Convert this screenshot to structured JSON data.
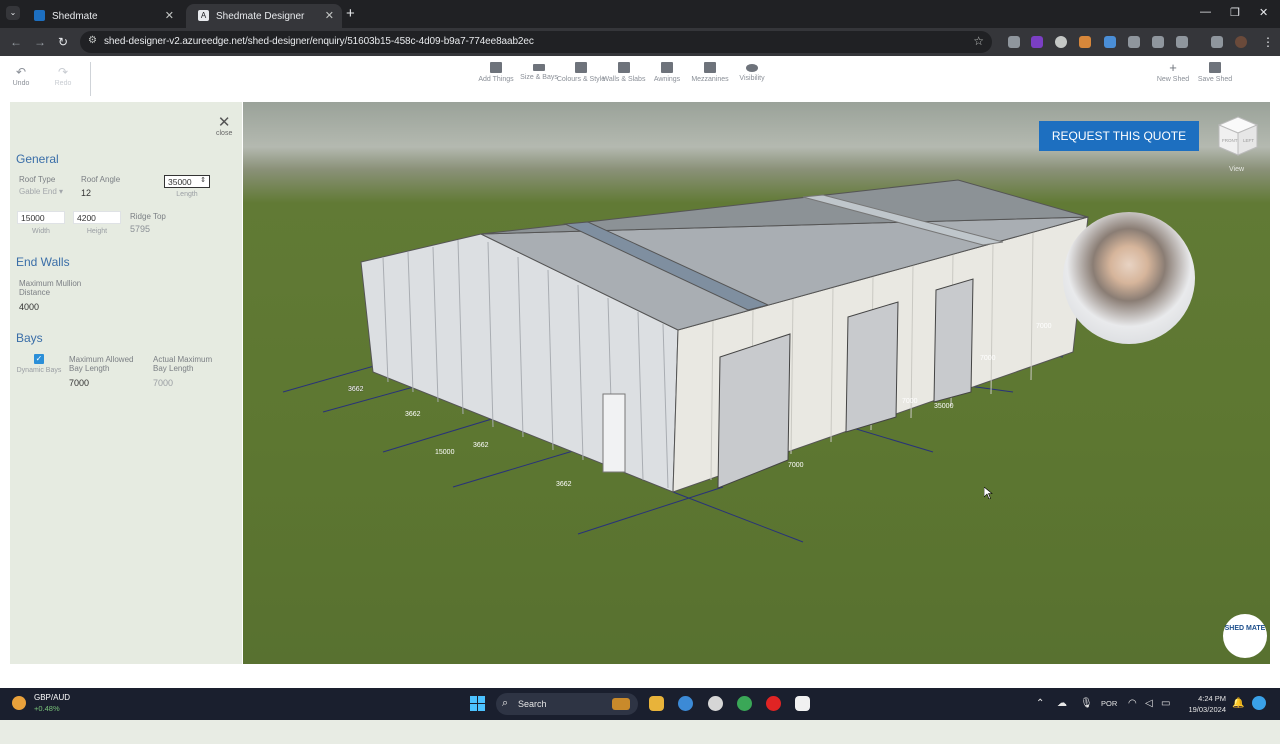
{
  "browser": {
    "tabs": [
      {
        "title": "Shedmate",
        "active": false
      },
      {
        "title": "Shedmate Designer",
        "active": true
      }
    ],
    "url": "shed-designer-v2.azureedge.net/shed-designer/enquiry/51603b15-458c-4d09-b9a7-774ee8aab2ec"
  },
  "toolbar": {
    "undo": "Undo",
    "redo": "Redo",
    "tools": [
      {
        "label": "Add Things",
        "icon": "add-things-icon"
      },
      {
        "label": "Size & Bays",
        "icon": "ruler-icon"
      },
      {
        "label": "Colours & Style",
        "icon": "paint-roller-icon"
      },
      {
        "label": "Walls & Slabs",
        "icon": "wall-icon"
      },
      {
        "label": "Awnings",
        "icon": "awning-icon"
      },
      {
        "label": "Mezzanines",
        "icon": "mezzanine-icon"
      },
      {
        "label": "Visibility",
        "icon": "eye-icon"
      }
    ],
    "new_shed": "New Shed",
    "save_shed": "Save Shed"
  },
  "panel": {
    "close": "close",
    "general": {
      "heading": "General",
      "roof_type_label": "Roof Type",
      "roof_type_value": "Gable End",
      "roof_angle_label": "Roof Angle",
      "roof_angle_value": "12",
      "length_value": "35000",
      "length_label": "Length",
      "width_value": "15000",
      "width_label": "Width",
      "height_value": "4200",
      "height_label": "Height",
      "ridge_top_label": "Ridge Top",
      "ridge_top_value": "5795"
    },
    "end_walls": {
      "heading": "End Walls",
      "mullion_label": "Maximum Mullion Distance",
      "mullion_value": "4000"
    },
    "bays": {
      "heading": "Bays",
      "dynamic_label": "Dynamic Bays",
      "dynamic_checked": true,
      "max_allowed_label": "Maximum Allowed Bay Length",
      "max_allowed_value": "7000",
      "actual_max_label": "Actual Maximum Bay Length",
      "actual_max_value": "7000"
    }
  },
  "viewport": {
    "request_quote": "REQUEST THIS QUOTE",
    "view_label": "View",
    "cube_faces": {
      "front": "FRONT",
      "left": "LEFT"
    },
    "logo": "SHED MATE",
    "dimensions": {
      "end_bays": [
        "3662",
        "3662",
        "3662",
        "3662"
      ],
      "width": "15000",
      "side_bays": [
        "7000",
        "7000",
        "7000",
        "7000"
      ],
      "length": "35000"
    }
  },
  "taskbar": {
    "ticker_pair": "GBP/AUD",
    "ticker_change": "+0.48%",
    "search": "Search",
    "language": "POR",
    "time": "4:24 PM",
    "date": "19/03/2024"
  },
  "colors": {
    "accent": "#1d6fc0",
    "section_heading": "#3a6ea8",
    "panel_bg": "#e6ebe1",
    "grass": "#5d7731"
  }
}
